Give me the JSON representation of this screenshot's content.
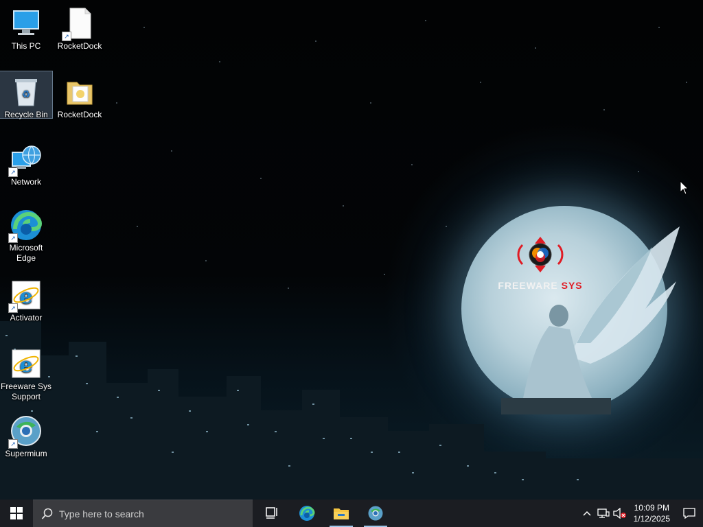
{
  "desktop": {
    "icons": [
      {
        "label": "This PC"
      },
      {
        "label": "RocketDock"
      },
      {
        "label": "Recycle Bin"
      },
      {
        "label": "RocketDock"
      },
      {
        "label": "Network"
      },
      {
        "label": "Microsoft Edge"
      },
      {
        "label": "Activator"
      },
      {
        "label": "Freeware Sys Support"
      },
      {
        "label": "Supermium"
      }
    ]
  },
  "wallpaper": {
    "brand_word1": "FREEWARE",
    "brand_word2": "SYS",
    "brand_colors": {
      "primary": "#e01b24",
      "text": "#f2f2f2"
    }
  },
  "taskbar": {
    "search_placeholder": "Type here to search",
    "pinned": [
      "task-view-icon",
      "edge-icon",
      "file-explorer-icon",
      "supermium-icon"
    ],
    "clock": {
      "time": "10:09 PM",
      "date": "1/12/2025"
    },
    "tray_icons": [
      "chevron-up-icon",
      "network-icon",
      "volume-muted-icon"
    ]
  }
}
